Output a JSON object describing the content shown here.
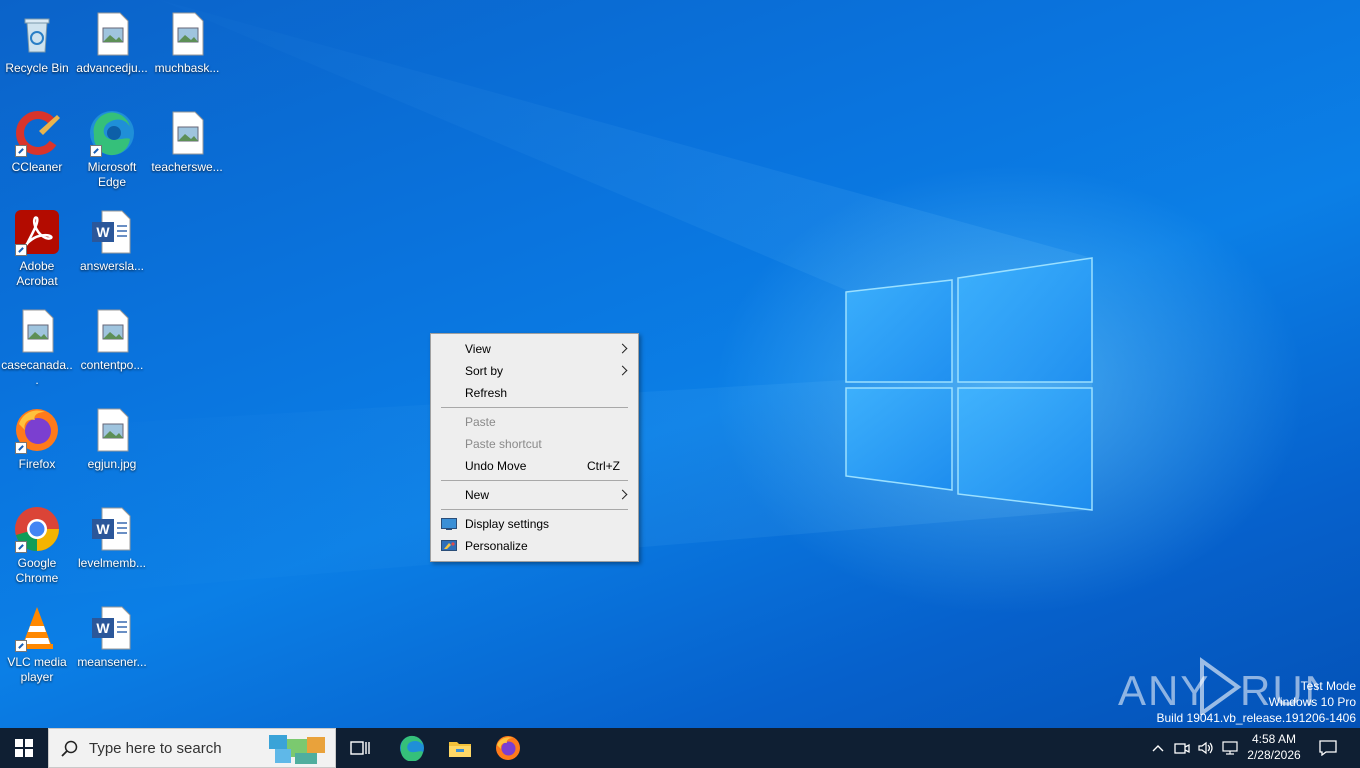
{
  "desktop": {
    "icons": [
      {
        "label": "Recycle Bin",
        "icon": "recycle-bin-icon"
      },
      {
        "label": "advancedju...",
        "icon": "image-file-icon"
      },
      {
        "label": "muchbask...",
        "icon": "image-file-icon"
      },
      {
        "label": "CCleaner",
        "icon": "ccleaner-icon"
      },
      {
        "label": "Microsoft Edge",
        "icon": "edge-icon"
      },
      {
        "label": "teacherswe...",
        "icon": "image-file-icon"
      },
      {
        "label": "Adobe Acrobat",
        "icon": "acrobat-icon"
      },
      {
        "label": "answersla...",
        "icon": "word-doc-icon"
      },
      {
        "label": "casecanada...",
        "icon": "image-file-icon"
      },
      {
        "label": "contentpo...",
        "icon": "image-file-icon"
      },
      {
        "label": "Firefox",
        "icon": "firefox-icon"
      },
      {
        "label": "egjun.jpg",
        "icon": "image-file-icon"
      },
      {
        "label": "Google Chrome",
        "icon": "chrome-icon"
      },
      {
        "label": "levelmemb...",
        "icon": "word-doc-icon"
      },
      {
        "label": "VLC media player",
        "icon": "vlc-icon"
      },
      {
        "label": "meansener...",
        "icon": "word-doc-icon"
      }
    ]
  },
  "context_menu": {
    "view": "View",
    "sort_by": "Sort by",
    "refresh": "Refresh",
    "paste": "Paste",
    "paste_shortcut": "Paste shortcut",
    "undo_move": "Undo Move",
    "undo_move_accel": "Ctrl+Z",
    "new": "New",
    "display_settings": "Display settings",
    "personalize": "Personalize"
  },
  "watermark": {
    "brand": "ANY RUN",
    "line1": "Test Mode",
    "line2": "Windows 10 Pro",
    "line3": "Build 19041.vb_release.191206-1406"
  },
  "taskbar": {
    "search_placeholder": "Type here to search",
    "time": "4:58 AM",
    "date": "2/28/2026"
  },
  "colors": {
    "taskbar": "#0f1f33",
    "wallpaper": "#0a74de",
    "menu": "#eeeeee"
  }
}
